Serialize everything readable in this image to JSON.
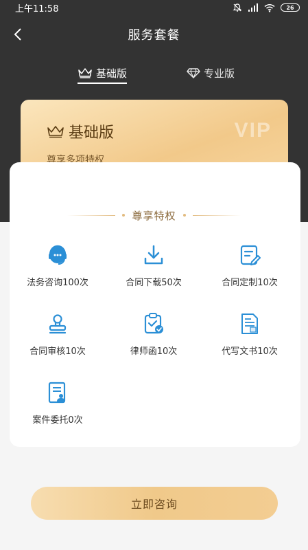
{
  "status_bar": {
    "time": "上午11:58",
    "battery": "26"
  },
  "nav": {
    "title": "服务套餐"
  },
  "tabs": [
    {
      "label": "基础版",
      "icon": "crown-icon",
      "active": true
    },
    {
      "label": "专业版",
      "icon": "diamond-icon",
      "active": false
    }
  ],
  "card": {
    "title": "基础版",
    "subtitle": "尊享多项特权",
    "watermark": "VIP"
  },
  "section": {
    "title": "尊享特权"
  },
  "features": [
    {
      "label": "法务咨询100次",
      "icon": "headset-icon"
    },
    {
      "label": "合同下载50次",
      "icon": "download-icon"
    },
    {
      "label": "合同定制10次",
      "icon": "document-edit-icon"
    },
    {
      "label": "合同审核10次",
      "icon": "stamp-icon"
    },
    {
      "label": "律师函10次",
      "icon": "clipboard-check-icon"
    },
    {
      "label": "代写文书10次",
      "icon": "text-document-icon"
    },
    {
      "label": "案件委托0次",
      "icon": "case-document-icon"
    }
  ],
  "cta": {
    "label": "立即咨询"
  },
  "colors": {
    "accent_blue": "#2b8fd6",
    "gold": "#f2c98a",
    "dark": "#333333"
  }
}
